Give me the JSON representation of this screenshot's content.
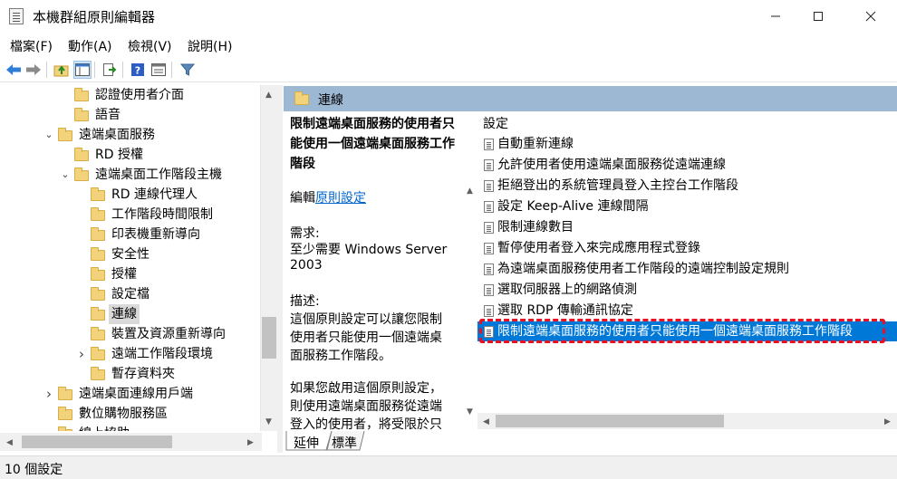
{
  "window": {
    "title": "本機群組原則編輯器",
    "minimize_icon": "minimize-icon",
    "maximize_icon": "maximize-icon",
    "close_icon": "close-icon"
  },
  "menu": {
    "file": "檔案(F)",
    "action": "動作(A)",
    "view": "檢視(V)",
    "help": "說明(H)"
  },
  "toolbar": {
    "icons": [
      "back-arrow-icon",
      "forward-arrow-icon",
      "up-folder-icon",
      "show-hide-tree-icon",
      "export-list-icon",
      "help-icon",
      "properties-icon",
      "filter-icon"
    ]
  },
  "tree": {
    "items": [
      {
        "label": "認證使用者介面",
        "expander": ""
      },
      {
        "label": "語音",
        "expander": ""
      },
      {
        "label": "遠端桌面服務",
        "expander": "expanded"
      },
      {
        "label": "RD 授權",
        "expander": ""
      },
      {
        "label": "遠端桌面工作階段主機",
        "expander": "expanded"
      },
      {
        "label": "RD 連線代理人",
        "expander": ""
      },
      {
        "label": "工作階段時間限制",
        "expander": ""
      },
      {
        "label": "印表機重新導向",
        "expander": ""
      },
      {
        "label": "安全性",
        "expander": ""
      },
      {
        "label": "授權",
        "expander": ""
      },
      {
        "label": "設定檔",
        "expander": ""
      },
      {
        "label": "連線",
        "expander": "",
        "selected": true
      },
      {
        "label": "裝置及資源重新導向",
        "expander": ""
      },
      {
        "label": "遠端工作階段環境",
        "expander": "collapsed"
      },
      {
        "label": "暫存資料夾",
        "expander": ""
      },
      {
        "label": "遠端桌面連線用戶端",
        "expander": "collapsed"
      },
      {
        "label": "數位購物服務區",
        "expander": ""
      },
      {
        "label": "線上協助",
        "expander": ""
      }
    ]
  },
  "right_header": {
    "title": "連線"
  },
  "description": {
    "heading_lines": [
      "限制遠端桌面服務的使用者只",
      "能使用一個遠端桌面服務工作",
      "階段"
    ],
    "edit_prefix": "編輯",
    "edit_link": "原則設定",
    "requirement_label": "需求:",
    "requirement_lines": [
      "至少需要 Windows Server",
      "2003"
    ],
    "desc_label": "描述:",
    "desc_lines": [
      "這個原則設定可以讓您限制",
      "使用者只能使用一個遠端桌",
      "面服務工作階段。"
    ],
    "desc2_lines": [
      "如果您啟用這個原則設定，",
      "則使用遠端桌面服務從遠端",
      "登入的使用者，將受限於只"
    ]
  },
  "settings": {
    "column_header": "設定",
    "items": [
      "自動重新連線",
      "允許使用者使用遠端桌面服務從遠端連線",
      "拒絕登出的系統管理員登入主控台工作階段",
      "設定 Keep-Alive 連線間隔",
      "限制連線數目",
      "暫停使用者登入來完成應用程式登錄",
      "為遠端桌面服務使用者工作階段的遠端控制設定規則",
      "選取伺服器上的網路偵測",
      "選取 RDP 傳輸通訊協定",
      "限制遠端桌面服務的使用者只能使用一個遠端桌面服務工作階段"
    ],
    "selected_index": 9
  },
  "tabs": {
    "extended": "延伸",
    "standard": "標準"
  },
  "status": {
    "text": "10 個設定"
  },
  "colors": {
    "header_bg": "#9cb8d3",
    "selection_bg": "#0078d7",
    "highlight_border": "#e81123",
    "link": "#0066cc",
    "status_bg": "#f0f0f0"
  }
}
